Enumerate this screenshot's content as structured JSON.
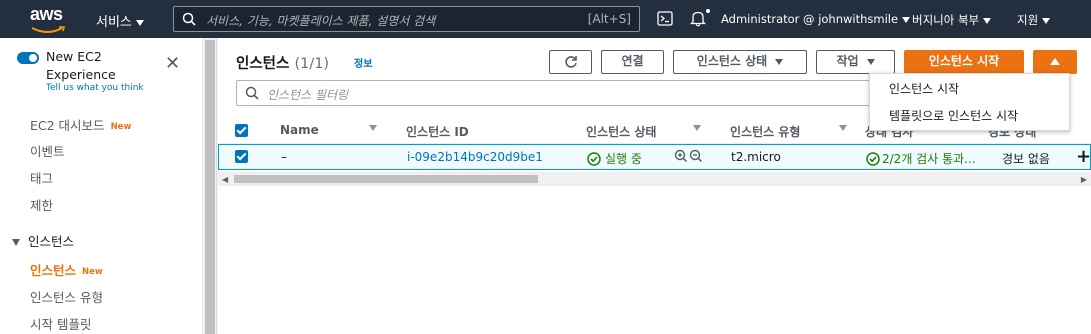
{
  "topbar": {
    "logo": "aws",
    "services": "서비스",
    "search_placeholder": "서비스, 기능, 마켓플레이스 제품, 설명서 검색",
    "search_shortcut": "[Alt+S]",
    "account": "Administrator @ johnwithsmile",
    "region": "버지니아 북부",
    "support": "지원"
  },
  "sidebar": {
    "experience_title": "New EC2 Experience",
    "experience_sub": "Tell us what you think",
    "items": [
      {
        "label": "EC2 대시보드",
        "badge": "New"
      },
      {
        "label": "이벤트"
      },
      {
        "label": "태그"
      },
      {
        "label": "제한"
      }
    ],
    "section": "인스턴스",
    "section_items": [
      {
        "label": "인스턴스",
        "badge": "New"
      },
      {
        "label": "인스턴스 유형"
      },
      {
        "label": "시작 템플릿"
      }
    ]
  },
  "panel": {
    "title": "인스턴스",
    "count": "(1/1)",
    "info": "정보",
    "buttons": {
      "connect": "연결",
      "state": "인스턴스 상태",
      "actions": "작업",
      "launch": "인스턴스 시작"
    },
    "filter_placeholder": "인스턴스 필터링",
    "columns": [
      "Name",
      "인스턴스 ID",
      "인스턴스 상태",
      "인스턴스 유형",
      "상태 검사",
      "경보 상태"
    ],
    "row": {
      "name": "–",
      "id": "i-09e2b14b9c20d9be1",
      "state": "실행 중",
      "type": "t2.micro",
      "check": "2/2개 검사 통과...",
      "alarm": "경보 없음"
    },
    "dropdown": [
      "인스턴스 시작",
      "템플릿으로 인스턴스 시작"
    ]
  },
  "colors": {
    "accent": "#ec7211",
    "link": "#0073bb",
    "ok": "#1d8102",
    "nav": "#232f3e"
  }
}
